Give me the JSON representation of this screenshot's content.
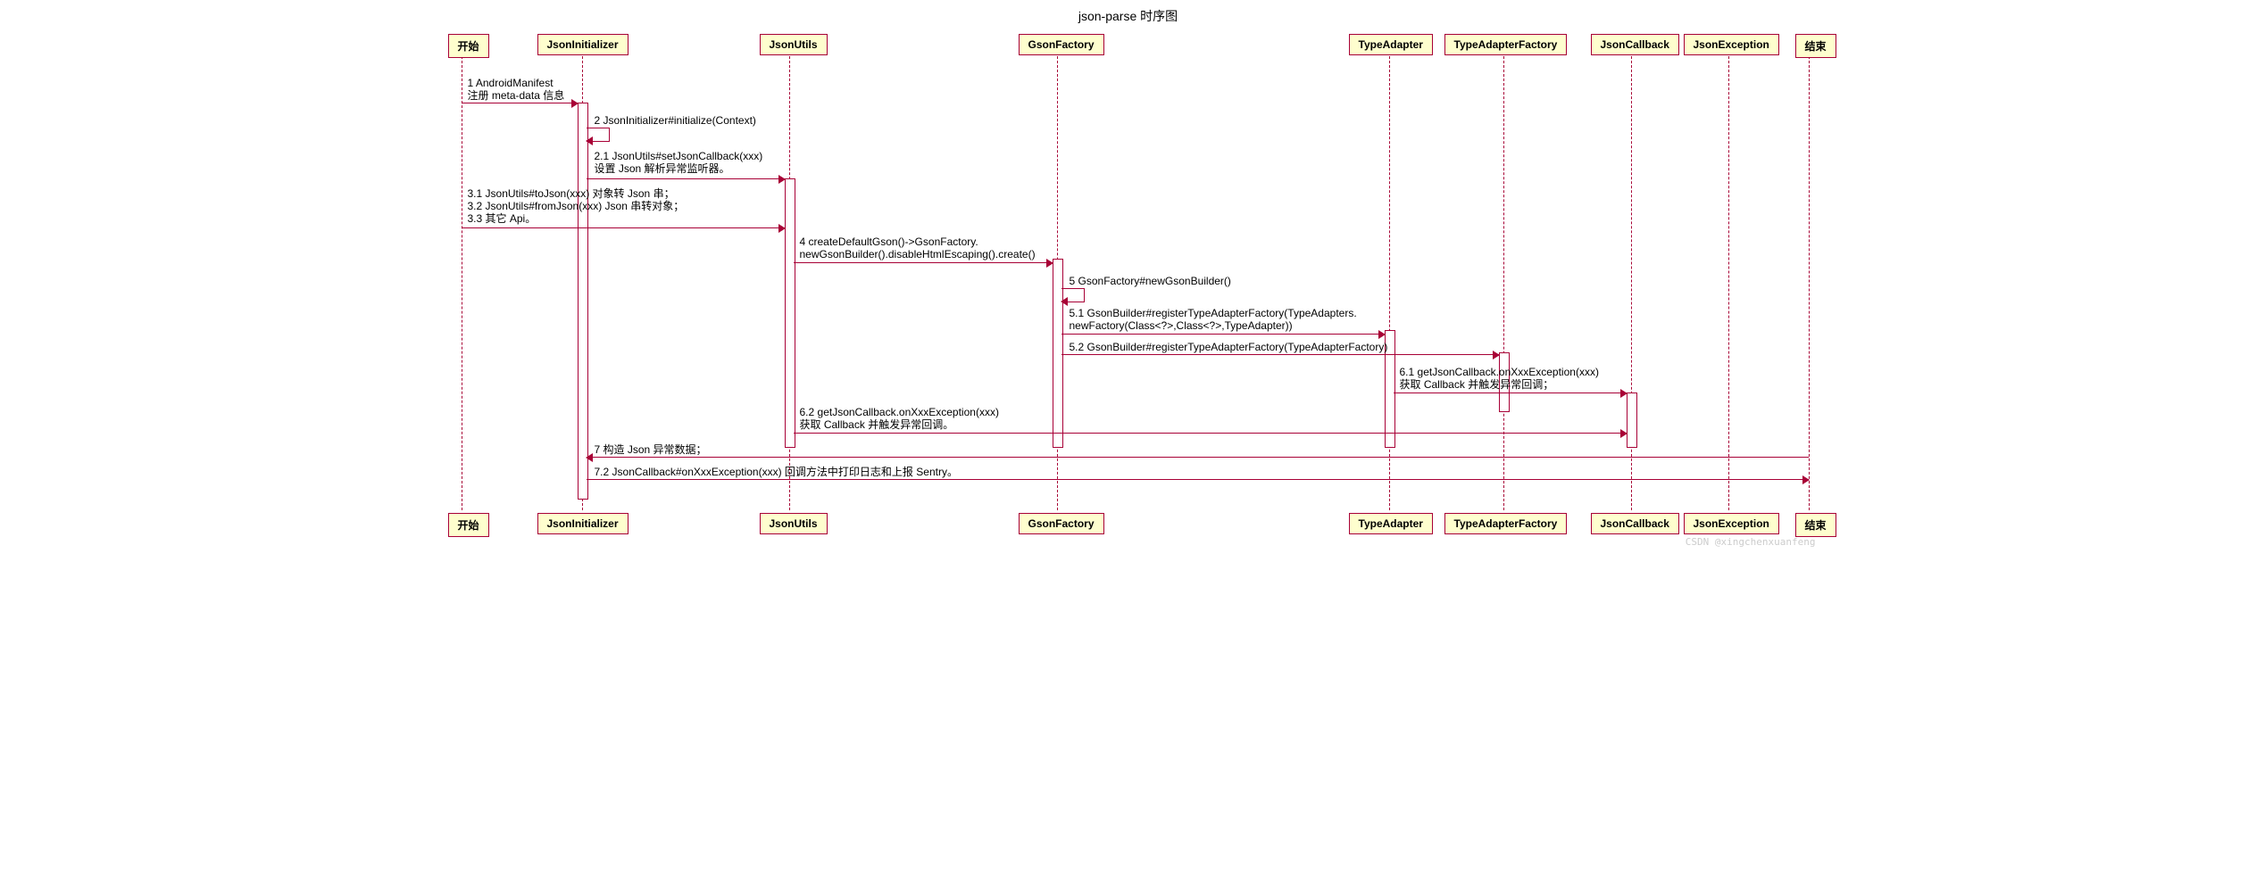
{
  "title": "json-parse 时序图",
  "participants": {
    "start": "开始",
    "jsonInitializer": "JsonInitializer",
    "jsonUtils": "JsonUtils",
    "gsonFactory": "GsonFactory",
    "typeAdapter": "TypeAdapter",
    "typeAdapterFactory": "TypeAdapterFactory",
    "jsonCallback": "JsonCallback",
    "jsonException": "JsonException",
    "end": "结束"
  },
  "messages": {
    "m1_l1": "1 AndroidManifest",
    "m1_l2": "注册 meta-data 信息",
    "m2": "2 JsonInitializer#initialize(Context)",
    "m2_1_l1": "2.1 JsonUtils#setJsonCallback(xxx)",
    "m2_1_l2": "设置 Json 解析异常监听器。",
    "m3_l1": "3.1 JsonUtils#toJson(xxx) 对象转 Json 串；",
    "m3_l2": "3.2 JsonUtils#fromJson(xxx) Json 串转对象；",
    "m3_l3": "3.3 其它 Api。",
    "m4_l1": "4 createDefaultGson()->GsonFactory.",
    "m4_l2": "newGsonBuilder().disableHtmlEscaping().create()",
    "m5": "5 GsonFactory#newGsonBuilder()",
    "m5_1_l1": "5.1 GsonBuilder#registerTypeAdapterFactory(TypeAdapters.",
    "m5_1_l2": "newFactory(Class<?>,Class<?>,TypeAdapter))",
    "m5_2": "5.2 GsonBuilder#registerTypeAdapterFactory(TypeAdapterFactory)",
    "m6_1_l1": "6.1 getJsonCallback.onXxxException(xxx)",
    "m6_1_l2": "获取 Callback 并触发异常回调；",
    "m6_2_l1": "6.2 getJsonCallback.onXxxException(xxx)",
    "m6_2_l2": "获取 Callback 并触发异常回调。",
    "m7": "7 构造 Json 异常数据；",
    "m7_2": "7.2 JsonCallback#onXxxException(xxx) 回调方法中打印日志和上报 Sentry。"
  },
  "watermark": "CSDN @xingchenxuanfeng",
  "chart_data": {
    "type": "sequence",
    "title": "json-parse 时序图",
    "participants": [
      "开始",
      "JsonInitializer",
      "JsonUtils",
      "GsonFactory",
      "TypeAdapter",
      "TypeAdapterFactory",
      "JsonCallback",
      "JsonException",
      "结束"
    ],
    "interactions": [
      {
        "n": "1",
        "from": "开始",
        "to": "JsonInitializer",
        "label": "AndroidManifest 注册 meta-data 信息"
      },
      {
        "n": "2",
        "from": "JsonInitializer",
        "to": "JsonInitializer",
        "label": "JsonInitializer#initialize(Context)",
        "self": true
      },
      {
        "n": "2.1",
        "from": "JsonInitializer",
        "to": "JsonUtils",
        "label": "JsonUtils#setJsonCallback(xxx) 设置 Json 解析异常监听器。"
      },
      {
        "n": "3",
        "from": "开始",
        "to": "JsonUtils",
        "label": "3.1 JsonUtils#toJson(xxx) 对象转 Json 串；3.2 JsonUtils#fromJson(xxx) Json 串转对象；3.3 其它 Api。"
      },
      {
        "n": "4",
        "from": "JsonUtils",
        "to": "GsonFactory",
        "label": "createDefaultGson()->GsonFactory.newGsonBuilder().disableHtmlEscaping().create()"
      },
      {
        "n": "5",
        "from": "GsonFactory",
        "to": "GsonFactory",
        "label": "GsonFactory#newGsonBuilder()",
        "self": true
      },
      {
        "n": "5.1",
        "from": "GsonFactory",
        "to": "TypeAdapter",
        "label": "GsonBuilder#registerTypeAdapterFactory(TypeAdapters.newFactory(Class<?>,Class<?>,TypeAdapter))"
      },
      {
        "n": "5.2",
        "from": "GsonFactory",
        "to": "TypeAdapterFactory",
        "label": "GsonBuilder#registerTypeAdapterFactory(TypeAdapterFactory)"
      },
      {
        "n": "6.1",
        "from": "TypeAdapter",
        "to": "JsonCallback",
        "label": "getJsonCallback.onXxxException(xxx) 获取 Callback 并触发异常回调；"
      },
      {
        "n": "6.2",
        "from": "JsonUtils",
        "to": "JsonCallback",
        "label": "getJsonCallback.onXxxException(xxx) 获取 Callback 并触发异常回调。"
      },
      {
        "n": "7",
        "from": "结束",
        "to": "JsonInitializer",
        "label": "构造 Json 异常数据；",
        "direction": "rtl"
      },
      {
        "n": "7.2",
        "from": "JsonInitializer",
        "to": "结束",
        "label": "JsonCallback#onXxxException(xxx) 回调方法中打印日志和上报 Sentry。"
      }
    ]
  }
}
